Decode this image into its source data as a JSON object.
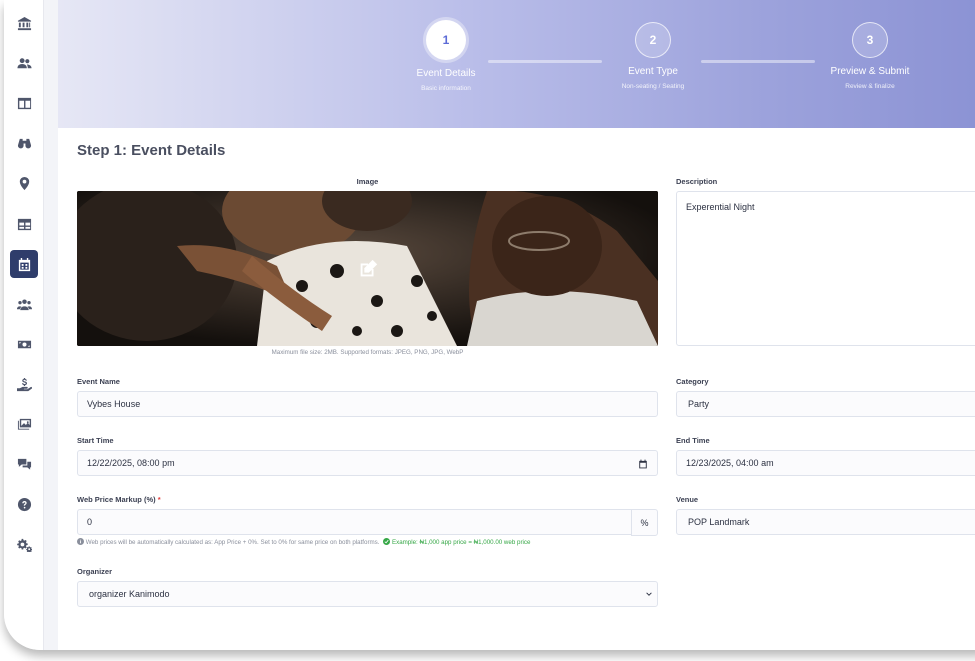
{
  "sidebar": {
    "items": [
      {
        "icon": "bank-icon"
      },
      {
        "icon": "users-icon"
      },
      {
        "icon": "columns-icon"
      },
      {
        "icon": "binoculars-icon"
      },
      {
        "icon": "location-pin-icon"
      },
      {
        "icon": "table-icon"
      },
      {
        "icon": "calendar-icon",
        "active": true
      },
      {
        "icon": "user-group-icon"
      },
      {
        "icon": "money-icon"
      },
      {
        "icon": "hand-holding-dollar-icon"
      },
      {
        "icon": "images-icon"
      },
      {
        "icon": "comments-icon"
      },
      {
        "icon": "question-circle-icon"
      },
      {
        "icon": "cogs-icon"
      }
    ]
  },
  "stepper": {
    "steps": [
      {
        "number": "1",
        "title": "Event Details",
        "subtitle": "Basic information",
        "active": true
      },
      {
        "number": "2",
        "title": "Event Type",
        "subtitle": "Non-seating / Seating",
        "active": false
      },
      {
        "number": "3",
        "title": "Preview & Submit",
        "subtitle": "Review & finalize",
        "active": false
      }
    ]
  },
  "page": {
    "title": "Step 1: Event Details"
  },
  "form": {
    "image": {
      "label": "Image",
      "hint": "Maximum file size: 2MB. Supported formats: JPEG, PNG, JPG, WebP"
    },
    "description": {
      "label": "Description",
      "value": "Experential Night"
    },
    "event_name": {
      "label": "Event Name",
      "value": "Vybes House"
    },
    "category": {
      "label": "Category",
      "value": "Party"
    },
    "start_time": {
      "label": "Start Time",
      "value": "12/22/2025, 08:00 pm"
    },
    "end_time": {
      "label": "End Time",
      "value": "12/23/2025, 04:00 am"
    },
    "markup": {
      "label": "Web Price Markup (%)",
      "required_mark": "*",
      "value": "0",
      "suffix": "%",
      "hint": "Web prices will be automatically calculated as: App Price + 0%. Set to 0% for same price on both platforms.",
      "example": "Example: ₦1,000 app price = ₦1,000.00 web price"
    },
    "venue": {
      "label": "Venue",
      "value": "POP Landmark"
    },
    "organizer": {
      "label": "Organizer",
      "value": "organizer Kanimodo"
    }
  },
  "colors": {
    "accent": "#5c6bd6",
    "sidebar_active": "#2f3d6b",
    "success": "#35a746",
    "required": "#e23b3b"
  }
}
